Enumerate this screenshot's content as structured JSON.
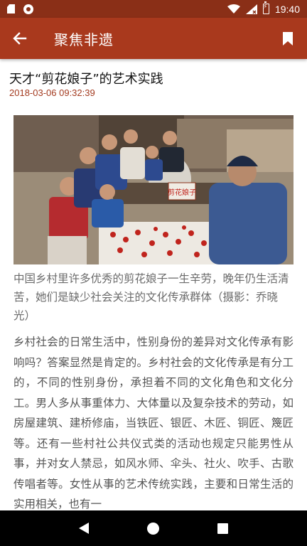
{
  "status_bar": {
    "time": "19:40",
    "icons": [
      "sd-card-icon",
      "record-icon",
      "wifi-icon",
      "signal-icon",
      "battery-charging-icon"
    ]
  },
  "app_bar": {
    "title": "聚焦非遗",
    "back_icon": "arrow-left-icon",
    "bookmark_icon": "bookmark-icon"
  },
  "article": {
    "title": "天才“剪花娘子”的艺术实践",
    "date": "2018-03-06 09:32:39",
    "photo_stamp": "剪花娘子",
    "caption": "中国乡村里许多优秀的剪花娘子一生辛劳，晚年仍生活清苦，她们是缺少社会关注的文化传承群体（摄影：乔晓光）",
    "body": "乡村社会的日常生活中，性别身份的差异对文化传承有影响吗？答案显然是肯定的。乡村社会的文化传承是有分工的，不同的性别身份，承担着不同的文化角色和文化分工。男人多从事重体力、大体量以及复杂技术的劳动，如房屋建筑、建桥修庙，当铁匠、银匠、木匠、铜匠、篾匠等。还有一些村社公共仪式类的活动也规定只能男性从事，并对女人禁忌，如风水师、伞头、社火、吹手、古歌传唱者等。女性从事的艺术传统实践，主要和日常生活的实用相关，也有一"
  },
  "colors": {
    "status_bar": "#8a2f17",
    "app_bar": "#a9391d",
    "date": "#a33a1f",
    "nav_bar": "#000000"
  },
  "nav_bar": {
    "buttons": [
      "back-triangle-icon",
      "home-circle-icon",
      "recents-square-icon"
    ]
  }
}
